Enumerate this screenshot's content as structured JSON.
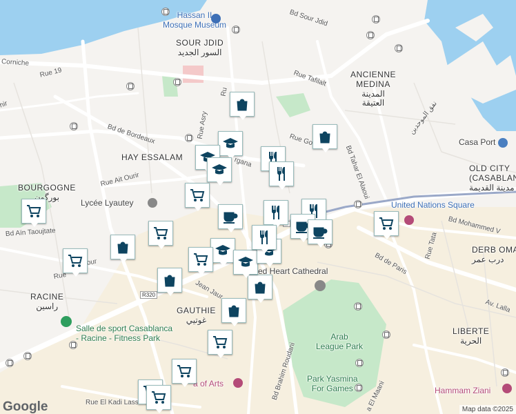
{
  "map": {
    "areas": [
      {
        "id": "sour-jdid",
        "name": "SOUR JDID",
        "name_ar": "السور الجديد"
      },
      {
        "id": "ancienne-medina",
        "name": "ANCIENNE\nMEDINA",
        "name_ar": "المدينة\nالعتيقة"
      },
      {
        "id": "hay-essalam",
        "name": "HAY ESSALAM",
        "name_ar": ""
      },
      {
        "id": "bourgogne",
        "name": "BOURGOGNE",
        "name_ar": "بورگون"
      },
      {
        "id": "old-city",
        "name": "OLD CITY\n(CASABLANC",
        "name_ar": "مدينة القديمة"
      },
      {
        "id": "derb-omar",
        "name": "DERB OMA",
        "name_ar": "درب عمر"
      },
      {
        "id": "racine",
        "name": "RACINE",
        "name_ar": "راسين"
      },
      {
        "id": "gauthier",
        "name": "GAUTHIE",
        "name_ar": "غوتيي"
      },
      {
        "id": "liberte",
        "name": "LIBERTE",
        "name_ar": "الحرية"
      }
    ],
    "pois": [
      {
        "id": "hassan-ii-museum",
        "name": "Hassan II\nMosque Museum",
        "color": "#3d6fb6"
      },
      {
        "id": "lycee-lyautey",
        "name": "Lycée Lyautey",
        "color": "#555555"
      },
      {
        "id": "casa-port",
        "name": "Casa Port",
        "color": "#555555"
      },
      {
        "id": "united-nations-square",
        "name": "United Nations Square",
        "color": "#3d6fb6"
      },
      {
        "id": "sacred-heart",
        "name": "red Heart Cathedral",
        "color": "#555555"
      },
      {
        "id": "arab-league-park",
        "name": "Arab\nLeague Park",
        "color": "#2e7d4f"
      },
      {
        "id": "park-yasmina",
        "name": "Park Yasmina\nFor Games",
        "color": "#2e7d4f"
      },
      {
        "id": "salle-sport",
        "name": "Salle de sport Casablanca\n- Racine - Fitness Park",
        "color": "#2e7d4f"
      },
      {
        "id": "villa-arts",
        "name": "a of Arts",
        "color": "#b44b78"
      },
      {
        "id": "hammam-ziani",
        "name": "Hammam Ziani",
        "color": "#b44b78"
      }
    ],
    "roads": [
      {
        "id": "bd-sour-jdid",
        "name": "Bd Sour Jdid"
      },
      {
        "id": "corniche",
        "name": "Corniche"
      },
      {
        "id": "rue-19",
        "name": "Rue 19"
      },
      {
        "id": "hir",
        "name": "hir"
      },
      {
        "id": "rue-tafilalt",
        "name": "Rue Tafilalt"
      },
      {
        "id": "rue-asry",
        "name": "Rue Asry"
      },
      {
        "id": "bd-bordeaux",
        "name": "Bd de Bordeaux"
      },
      {
        "id": "rue-goulmima",
        "name": "Rue Go"
      },
      {
        "id": "bd-tahar",
        "name": "Bd Tahar El Alaoui"
      },
      {
        "id": "bd-almohades",
        "name": "نفق الموحدين"
      },
      {
        "id": "rue-ait-ourir",
        "name": "Rue Ait Ourir"
      },
      {
        "id": "bd-ain-taoujtate",
        "name": "Bd Aïn Taoujtate"
      },
      {
        "id": "bd-mohammed-v",
        "name": "Bd Mohammed V"
      },
      {
        "id": "rue-tata",
        "name": "Rue Tata"
      },
      {
        "id": "bd-paris",
        "name": "Bd de Paris"
      },
      {
        "id": "av-lalla",
        "name": "Av. Lalla"
      },
      {
        "id": "jean-jaures",
        "name": "Jean Jaur"
      },
      {
        "id": "bd-brahim",
        "name": "Bd Brahim Roudani"
      },
      {
        "id": "rue-kadi",
        "name": "Rue El Kadi Lass"
      },
      {
        "id": "el-maani",
        "name": "a El Maani"
      },
      {
        "id": "rue-our",
        "name": "our"
      },
      {
        "id": "rue-rue",
        "name": "Rue"
      },
      {
        "id": "ru",
        "name": "Ru"
      },
      {
        "id": "rg",
        "name": "rgana"
      }
    ],
    "route_shields": [
      "R320"
    ],
    "markers": [
      {
        "type": "shop"
      },
      {
        "type": "shop"
      },
      {
        "type": "shop"
      },
      {
        "type": "shop"
      },
      {
        "type": "shop"
      },
      {
        "type": "shop"
      },
      {
        "type": "school"
      },
      {
        "type": "school"
      },
      {
        "type": "school"
      },
      {
        "type": "school"
      },
      {
        "type": "school"
      },
      {
        "type": "school"
      },
      {
        "type": "restaurant"
      },
      {
        "type": "restaurant"
      },
      {
        "type": "restaurant"
      },
      {
        "type": "restaurant"
      },
      {
        "type": "restaurant"
      },
      {
        "type": "cafe"
      },
      {
        "type": "cafe"
      },
      {
        "type": "cafe"
      },
      {
        "type": "cart"
      },
      {
        "type": "cart"
      },
      {
        "type": "cart"
      },
      {
        "type": "cart"
      },
      {
        "type": "cart"
      },
      {
        "type": "cart"
      },
      {
        "type": "cart"
      },
      {
        "type": "cart"
      },
      {
        "type": "cart"
      },
      {
        "type": "cart"
      }
    ],
    "colors": {
      "water": "#9dd0f0",
      "land": "#f5f3f0",
      "park": "#c6e8c9",
      "urban": "#f7edd4",
      "road": "#ffffff",
      "marker_icon": "#0e4460"
    }
  },
  "footer": {
    "logo": "Google",
    "attribution": "Map data ©2025"
  }
}
